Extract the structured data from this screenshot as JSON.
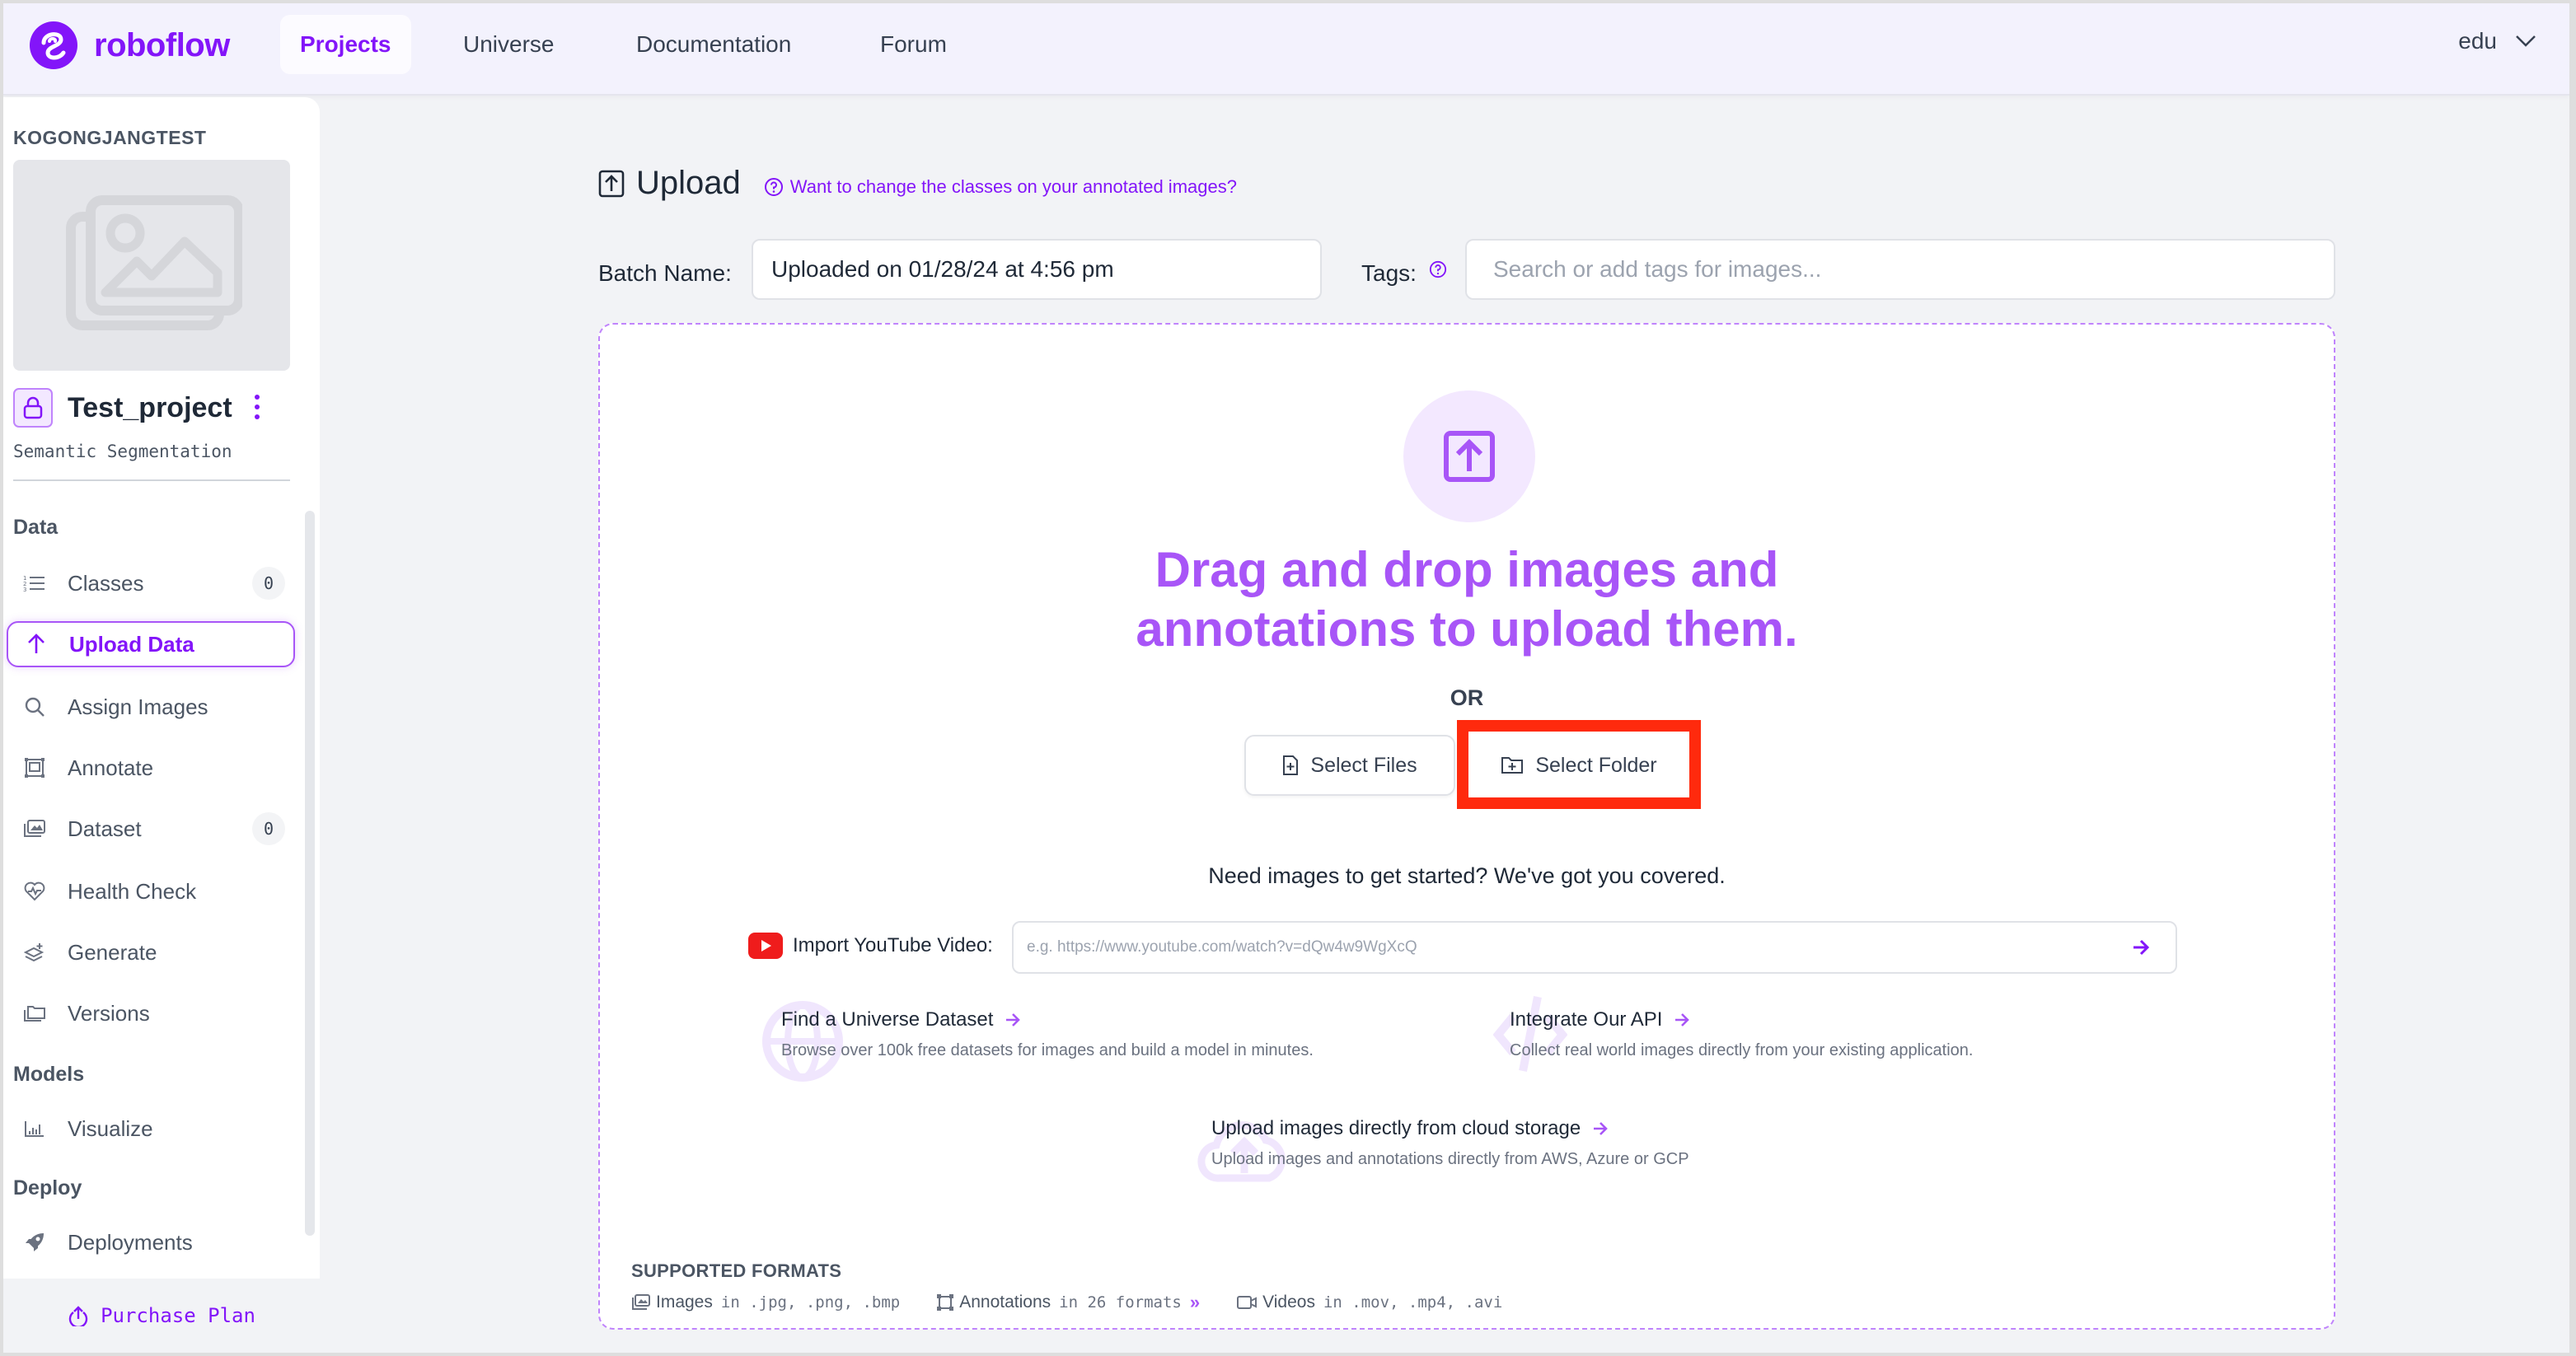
{
  "app": {
    "brand": "roboflow",
    "brand_color": "#8315f9"
  },
  "nav": {
    "items": [
      {
        "label": "Projects",
        "active": true
      },
      {
        "label": "Universe",
        "active": false
      },
      {
        "label": "Documentation",
        "active": false
      },
      {
        "label": "Forum",
        "active": false
      }
    ],
    "user": {
      "label": "edu",
      "icon": "chevron-down-icon"
    }
  },
  "sidebar": {
    "workspace": "KOGONGJANGTEST",
    "project": {
      "name": "Test_project",
      "type": "Semantic Segmentation",
      "visibility_icon": "lock-icon"
    },
    "sections": [
      {
        "title": "Data",
        "items": [
          {
            "label": "Classes",
            "icon": "numbered-list-icon",
            "count": "0"
          },
          {
            "label": "Upload Data",
            "icon": "arrow-up-icon",
            "active": true
          },
          {
            "label": "Assign Images",
            "icon": "search-icon"
          },
          {
            "label": "Annotate",
            "icon": "annotate-icon"
          },
          {
            "label": "Dataset",
            "icon": "images-icon",
            "count": "0"
          },
          {
            "label": "Health Check",
            "icon": "heart-pulse-icon"
          },
          {
            "label": "Generate",
            "icon": "layers-plus-icon"
          },
          {
            "label": "Versions",
            "icon": "folders-icon"
          }
        ]
      },
      {
        "title": "Models",
        "items": [
          {
            "label": "Visualize",
            "icon": "bar-chart-icon"
          }
        ]
      },
      {
        "title": "Deploy",
        "items": [
          {
            "label": "Deployments",
            "icon": "rocket-icon"
          }
        ]
      }
    ],
    "purchase_label": "Purchase Plan"
  },
  "upload": {
    "title": "Upload",
    "help_link": "Want to change the classes on your annotated images?",
    "batch_label": "Batch Name:",
    "batch_value": "Uploaded on 01/28/24 at 4:56 pm",
    "tags_label": "Tags:",
    "tags_placeholder": "Search or add tags for images...",
    "dropzone": {
      "heading_line1": "Drag and drop images and",
      "heading_line2": "annotations to upload them.",
      "or": "OR",
      "select_files": "Select Files",
      "select_folder": "Select Folder",
      "highlight": "Select Folder",
      "highlight_color": "#ff2a0d"
    },
    "need_images": "Need images to get started? We've got you covered.",
    "youtube": {
      "label": "Import YouTube Video:",
      "placeholder": "e.g. https://www.youtube.com/watch?v=dQw4w9WgXcQ"
    },
    "cards": [
      {
        "title": "Find a Universe Dataset",
        "desc": "Browse over 100k free datasets for images and build a model in minutes.",
        "icon": "globe-icon"
      },
      {
        "title": "Integrate Our API",
        "desc": "Collect real world images directly from your existing application.",
        "icon": "code-icon"
      },
      {
        "title": "Upload images directly from cloud storage",
        "desc": "Upload images and annotations directly from AWS, Azure or GCP",
        "icon": "cloud-upload-icon"
      }
    ],
    "formats": {
      "title": "SUPPORTED FORMATS",
      "images": {
        "label": "Images",
        "text": "in .jpg, .png, .bmp"
      },
      "annotations": {
        "label": "Annotations",
        "text": "in 26 formats",
        "more": "»"
      },
      "videos": {
        "label": "Videos",
        "text": "in .mov, .mp4, .avi"
      }
    }
  }
}
